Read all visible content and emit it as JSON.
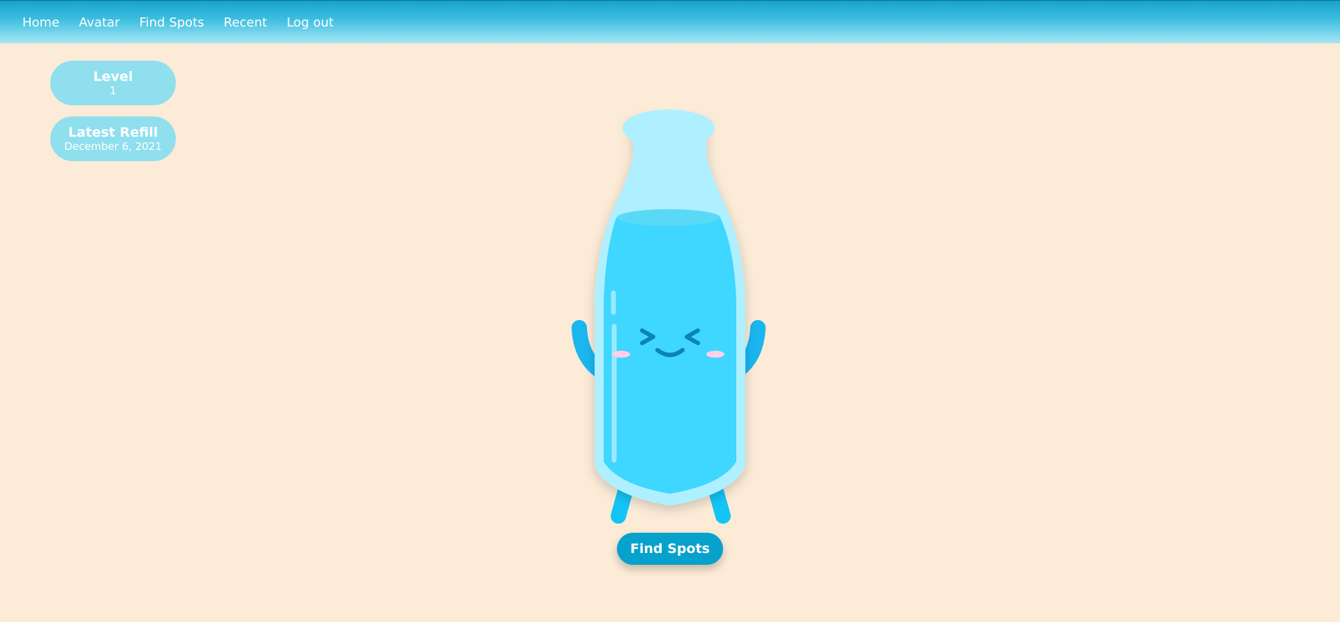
{
  "nav": {
    "items": [
      "Home",
      "Avatar",
      "Find Spots",
      "Recent",
      "Log out"
    ]
  },
  "stats": {
    "level": {
      "title": "Level",
      "value": "1"
    },
    "latest_refill": {
      "title": "Latest Refill",
      "value": "December 6, 2021"
    }
  },
  "mascot": {
    "icon": "water-bottle-mascot-icon"
  },
  "actions": {
    "find_spots_label": "Find Spots"
  },
  "colors": {
    "nav_top": "#16a2cc",
    "nav_bottom": "#a7e6f4",
    "background": "#fbebd7",
    "pill": "#8fdfee",
    "button": "#07a2cc",
    "water": "#3fd6ff",
    "bottle_glass": "#aef0ff"
  }
}
